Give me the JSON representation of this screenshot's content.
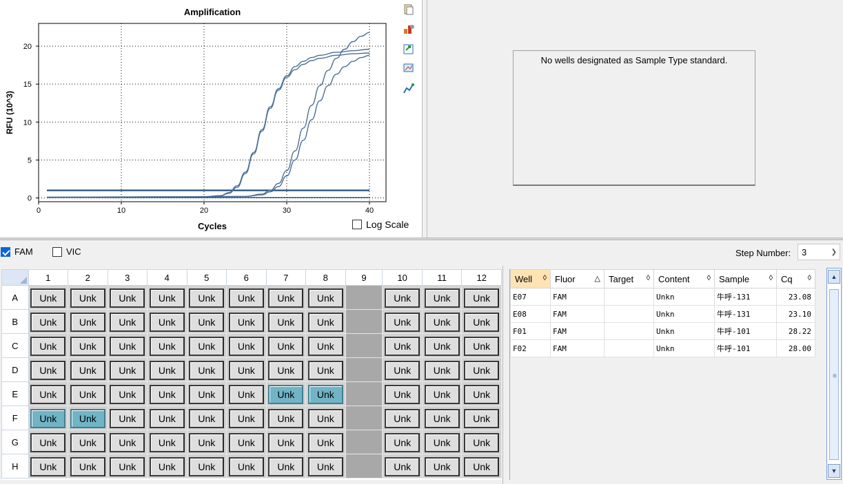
{
  "chart_data": {
    "type": "line",
    "title": "Amplification",
    "xlabel": "Cycles",
    "ylabel": "RFU (10^3)",
    "xlim": [
      0,
      42
    ],
    "ylim": [
      -0.5,
      23
    ],
    "x_ticks": [
      0,
      10,
      20,
      30,
      40
    ],
    "y_ticks": [
      0,
      5,
      10,
      15,
      20
    ],
    "grid": "dotted",
    "series": [
      {
        "well": "E07",
        "points": [
          [
            1,
            0.1
          ],
          [
            20,
            0.15
          ],
          [
            22,
            0.3
          ],
          [
            23,
            0.7
          ],
          [
            24,
            1.6
          ],
          [
            25,
            3.4
          ],
          [
            26,
            6.0
          ],
          [
            27,
            9.0
          ],
          [
            28,
            12.0
          ],
          [
            29,
            14.4
          ],
          [
            30,
            16.1
          ],
          [
            31,
            17.3
          ],
          [
            32,
            18.0
          ],
          [
            33,
            18.5
          ],
          [
            34,
            18.8
          ],
          [
            36,
            19.2
          ],
          [
            38,
            19.4
          ],
          [
            40,
            19.6
          ]
        ]
      },
      {
        "well": "E08",
        "points": [
          [
            1,
            0.1
          ],
          [
            20,
            0.15
          ],
          [
            22,
            0.3
          ],
          [
            23,
            0.6
          ],
          [
            24,
            1.4
          ],
          [
            25,
            3.2
          ],
          [
            26,
            5.8
          ],
          [
            27,
            8.8
          ],
          [
            28,
            11.8
          ],
          [
            29,
            14.2
          ],
          [
            30,
            15.9
          ],
          [
            31,
            16.9
          ],
          [
            32,
            17.6
          ],
          [
            33,
            18.1
          ],
          [
            34,
            18.4
          ],
          [
            36,
            18.8
          ],
          [
            38,
            19.0
          ],
          [
            40,
            19.1
          ]
        ]
      },
      {
        "well": "F01",
        "points": [
          [
            1,
            0.05
          ],
          [
            25,
            0.2
          ],
          [
            27,
            0.5
          ],
          [
            28,
            1.0
          ],
          [
            29,
            1.9
          ],
          [
            30,
            3.6
          ],
          [
            31,
            6.2
          ],
          [
            32,
            9.2
          ],
          [
            33,
            12.2
          ],
          [
            34,
            14.8
          ],
          [
            35,
            16.8
          ],
          [
            36,
            18.4
          ],
          [
            37,
            19.6
          ],
          [
            38,
            20.6
          ],
          [
            39,
            21.3
          ],
          [
            40,
            21.8
          ]
        ]
      },
      {
        "well": "F02",
        "points": [
          [
            1,
            0.05
          ],
          [
            25,
            0.2
          ],
          [
            27,
            0.4
          ],
          [
            28,
            0.8
          ],
          [
            29,
            1.5
          ],
          [
            30,
            2.9
          ],
          [
            31,
            5.0
          ],
          [
            32,
            7.6
          ],
          [
            33,
            10.3
          ],
          [
            34,
            12.8
          ],
          [
            35,
            14.8
          ],
          [
            36,
            16.3
          ],
          [
            37,
            17.3
          ],
          [
            38,
            18.0
          ],
          [
            39,
            18.5
          ],
          [
            40,
            18.8
          ]
        ]
      }
    ],
    "threshold": 1.0
  },
  "chart_controls": {
    "log_scale_label": "Log Scale",
    "log_scale_checked": false,
    "tool_icons": [
      "copy-icon",
      "chart-settings-icon",
      "export-icon",
      "zoom-icon",
      "trace-icon"
    ]
  },
  "standard_curve": {
    "message": "No wells designated as Sample Type standard."
  },
  "filters": {
    "fam_label": "FAM",
    "fam_checked": true,
    "vic_label": "VIC",
    "vic_checked": false,
    "step_label": "Step Number:",
    "step_value": "3"
  },
  "plate": {
    "columns": [
      "1",
      "2",
      "3",
      "4",
      "5",
      "6",
      "7",
      "8",
      "9",
      "10",
      "11",
      "12"
    ],
    "rows": [
      "A",
      "B",
      "C",
      "D",
      "E",
      "F",
      "G",
      "H"
    ],
    "well_label": "Unk",
    "empty_column": "9",
    "selected_wells": [
      "E7",
      "E8",
      "F1",
      "F2"
    ]
  },
  "results": {
    "headers": [
      "Well",
      "Fluor",
      "Target",
      "Content",
      "Sample",
      "Cq"
    ],
    "sort_icons": [
      "◊",
      "△",
      "◊",
      "◊",
      "◊",
      "◊"
    ],
    "rows": [
      [
        "E07",
        "FAM",
        "",
        "Unkn",
        "牛呼-131",
        "23.08"
      ],
      [
        "E08",
        "FAM",
        "",
        "Unkn",
        "牛呼-131",
        "23.10"
      ],
      [
        "F01",
        "FAM",
        "",
        "Unkn",
        "牛呼-101",
        "28.22"
      ],
      [
        "F02",
        "FAM",
        "",
        "Unkn",
        "牛呼-101",
        "28.00"
      ]
    ]
  },
  "colors": {
    "curve": "#4a6f95",
    "threshold": "#1f4e79",
    "selected_well": "#70b4c6",
    "sorted_header": "#ffe3b3"
  }
}
